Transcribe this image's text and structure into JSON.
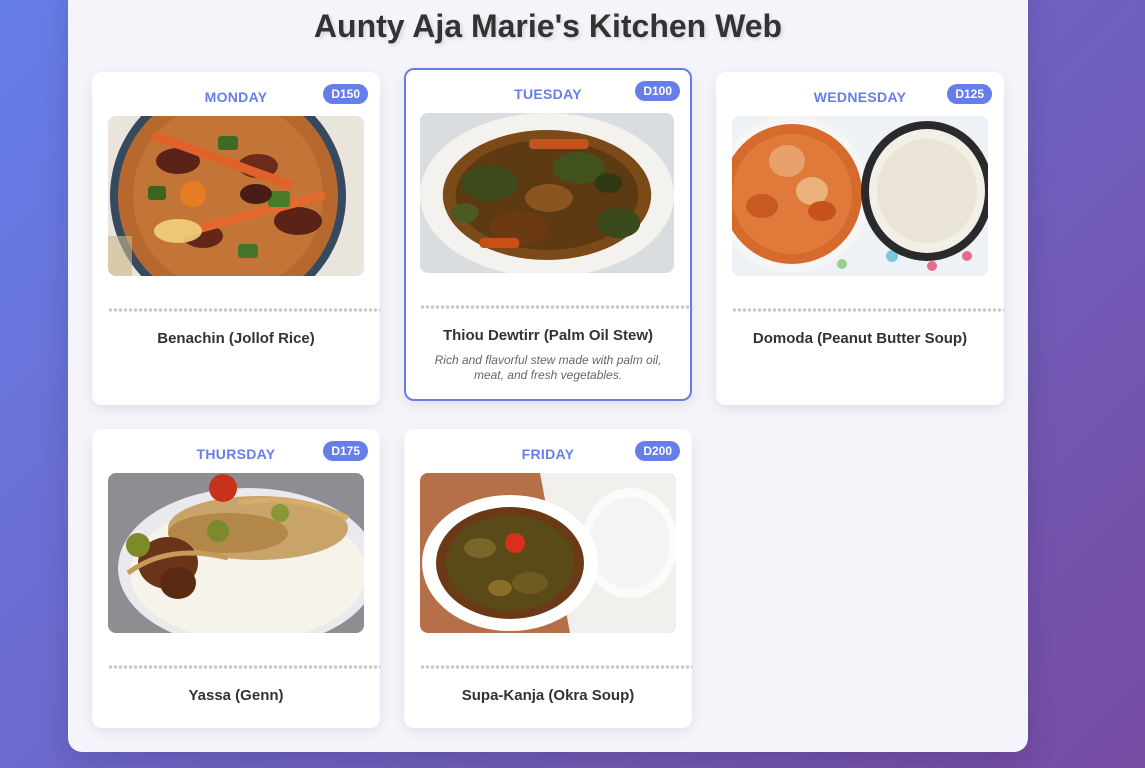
{
  "page": {
    "title": "Aunty Aja Marie's Kitchen Web"
  },
  "menu": [
    {
      "day": "MONDAY",
      "price": "D150",
      "dish": "Benachin (Jollof Rice)",
      "description": "",
      "photo_icon": "jollof-rice-photo"
    },
    {
      "day": "TUESDAY",
      "price": "D100",
      "dish": "Thiou Dewtirr (Palm Oil Stew)",
      "description": "Rich and flavorful stew made with palm oil, meat, and fresh vegetables.",
      "photo_icon": "palm-oil-stew-photo"
    },
    {
      "day": "WEDNESDAY",
      "price": "D125",
      "dish": "Domoda (Peanut Butter Soup)",
      "description": "",
      "photo_icon": "peanut-butter-soup-photo"
    },
    {
      "day": "THURSDAY",
      "price": "D175",
      "dish": "Yassa (Genn)",
      "description": "",
      "photo_icon": "yassa-photo"
    },
    {
      "day": "FRIDAY",
      "price": "D200",
      "dish": "Supa-Kanja (Okra Soup)",
      "description": "",
      "photo_icon": "okra-soup-photo"
    }
  ],
  "colors": {
    "accent": "#667eea",
    "background_start": "#667eea",
    "background_end": "#764ba2"
  }
}
